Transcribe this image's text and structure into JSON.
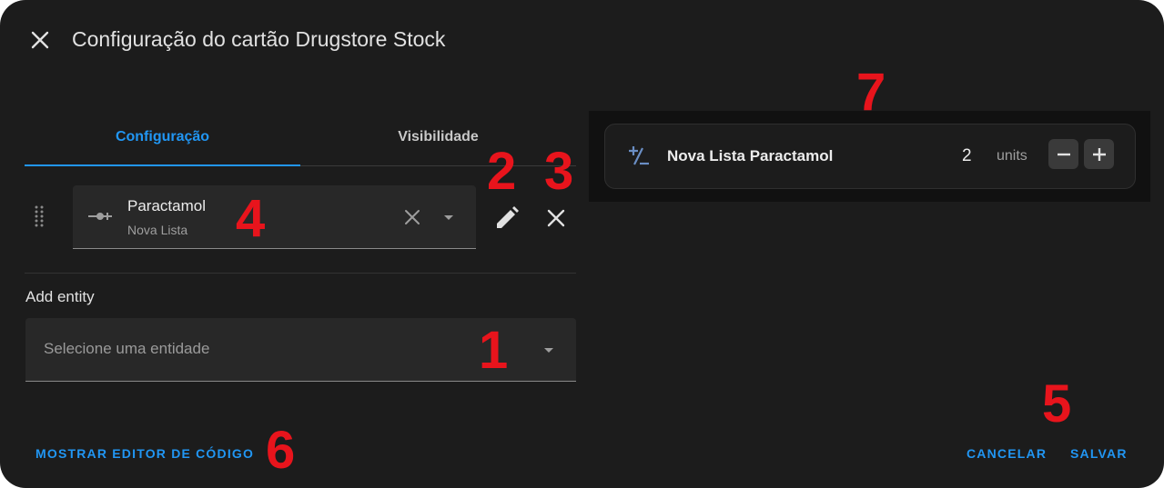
{
  "dialog": {
    "title": "Configuração do cartão Drugstore Stock"
  },
  "tabs": [
    {
      "label": "Configuração",
      "active": true
    },
    {
      "label": "Visibilidade",
      "active": false
    }
  ],
  "entity": {
    "name": "Paractamol",
    "subtitle": "Nova Lista"
  },
  "add_entity": {
    "label": "Add entity",
    "placeholder": "Selecione uma entidade"
  },
  "preview": {
    "title": "Nova Lista Paractamol",
    "count": "2",
    "unit": "units"
  },
  "footer": {
    "code_editor": "MOSTRAR EDITOR DE CÓDIGO",
    "cancel": "CANCELAR",
    "save": "SALVAR"
  },
  "annotations": [
    "1",
    "2",
    "3",
    "4",
    "5",
    "6",
    "7"
  ],
  "colors": {
    "accent": "#2196f3",
    "annotation": "#e8141c",
    "background": "#1c1c1c"
  },
  "icons": [
    "close-icon",
    "drag-handle-icon",
    "entity-icon",
    "clear-icon",
    "chevron-down-icon",
    "pencil-icon",
    "plus-minus-icon",
    "minus-icon",
    "plus-icon"
  ]
}
